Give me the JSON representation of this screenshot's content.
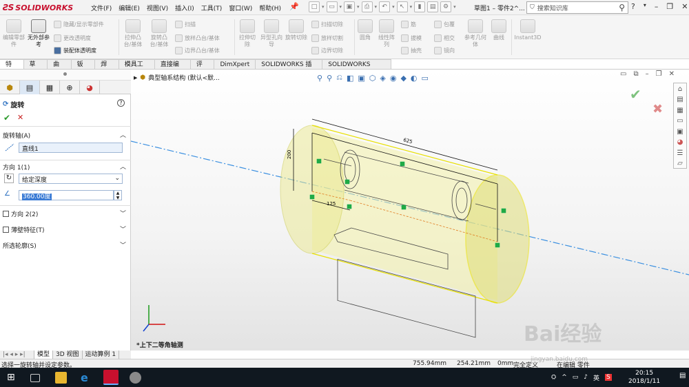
{
  "app": {
    "name": "SOLIDWORKS"
  },
  "menu": [
    "文件(F)",
    "编辑(E)",
    "视图(V)",
    "插入(I)",
    "工具(T)",
    "窗口(W)",
    "帮助(H)"
  ],
  "doc_title": "草图1 – 零件2^...",
  "search": {
    "placeholder": "搜索知识库"
  },
  "ribbon": {
    "edit_part": "编辑零部件",
    "no_external": "无外部参考",
    "hide_show": "隐藏/显示零部件",
    "change_transparency": "更改透明度",
    "assembly_transparency": "装配体透明度",
    "boss_base": "拉伸凸台/基体",
    "revolve_boss": "旋转凸台/基体",
    "sweep": "扫描",
    "loft_boss": "放样凸台/基体",
    "boundary_boss": "边界凸台/基体",
    "extrude_cut": "拉伸切除",
    "hole_wizard": "异型孔向导",
    "revolve_cut": "旋转切除",
    "sweep_cut": "扫描切除",
    "loft_cut": "放样切割",
    "boundary_cut": "边界切除",
    "fillet": "圆角",
    "linear_pattern": "线性阵列",
    "rib": "筋",
    "draft": "拔模",
    "shell": "抽壳",
    "wrap": "包覆",
    "intersect": "相交",
    "mirror": "镜向",
    "ref_geometry": "参考几何体",
    "curves": "曲线",
    "instant3d": "Instant3D"
  },
  "tabs": [
    "特征",
    "草图",
    "曲面",
    "钣金",
    "焊件",
    "模具工具",
    "直接编辑",
    "评估",
    "DimXpert",
    "SOLIDWORKS 插件",
    "SOLIDWORKS MBD"
  ],
  "property_manager": {
    "title": "旋转",
    "axis_section": "旋转轴(A)",
    "axis_value": "直线1",
    "direction1": "方向 1(1)",
    "end_condition": "给定深度",
    "angle": "360.00度",
    "direction2": "方向 2(2)",
    "thin_feature": "薄壁特征(T)",
    "contours": "所选轮廓(S)"
  },
  "viewport": {
    "tree_label": "典型轴系结构 (默认<默...",
    "view_name": "*上下二等角轴测",
    "dims": {
      "length": "625",
      "height": "200",
      "offset": "125"
    }
  },
  "bottom_tabs": [
    "模型",
    "3D 视图",
    "运动算例 1"
  ],
  "status": {
    "hint": "选择一旋转轴并设定参数。",
    "x": "755.94mm",
    "y": "254.21mm",
    "z": "0mm",
    "state": "完全定义",
    "editing": "在编辑 零件"
  },
  "taskbar": {
    "ime": "英",
    "time": "20:15",
    "date": "2018/1/11"
  },
  "watermark": {
    "text": "Bai经验",
    "url": "jingyan.baidu.com"
  },
  "colors": {
    "accent": "#c8102e",
    "confirm": "#2a9a2a",
    "cancel": "#c82020",
    "axis": "#3a8fe0",
    "shell": "#f2f0a8"
  }
}
